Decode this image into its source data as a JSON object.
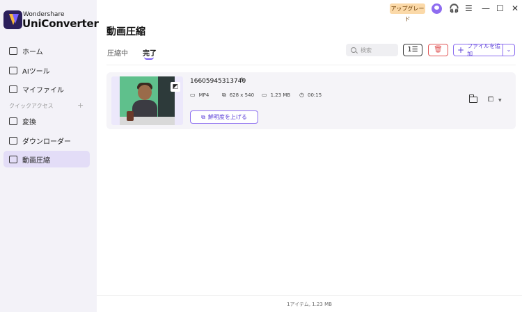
{
  "app": {
    "brand_small": "Wondershare",
    "brand_big": "UniConverter"
  },
  "topbar": {
    "upgrade_label": "アップグレード",
    "icons": [
      "avatar-icon",
      "headset-icon",
      "menu-list-icon",
      "minimize-icon",
      "maximize-icon",
      "close-icon"
    ],
    "glyphs": {
      "headset": "🎧",
      "menu": "☰",
      "minimize": "—",
      "maximize": "☐",
      "close": "✕"
    }
  },
  "sidebar": {
    "items": [
      {
        "label": "ホーム",
        "icon": "home-icon"
      },
      {
        "label": "AIツール",
        "icon": "ai-tools-icon"
      },
      {
        "label": "マイファイル",
        "icon": "my-files-icon"
      }
    ],
    "quick_access_label": "クイックアクセス",
    "quick_access_plus": "+",
    "quick_items": [
      {
        "label": "変換",
        "icon": "convert-icon"
      },
      {
        "label": "ダウンローダー",
        "icon": "downloader-icon"
      },
      {
        "label": "動画圧縮",
        "icon": "video-compress-icon",
        "active": true
      }
    ]
  },
  "main": {
    "title": "動画圧縮",
    "tabs": [
      {
        "label": "圧縮中",
        "active": false
      },
      {
        "label": "完了",
        "active": true
      }
    ],
    "search_placeholder": "検索",
    "list_button_glyph": "1☰",
    "trash_glyph": "🗑",
    "add_file_label": "ファイルを追加",
    "add_file_plus": "+",
    "add_dropdown_glyph": "⌄"
  },
  "file": {
    "name": "16605945313740",
    "edit_glyph": "✎",
    "format": "MP4",
    "resolution": "628 x 540",
    "size": "1.23 MB",
    "duration": "00:15",
    "meta_glyphs": {
      "format": "▭",
      "resolution": "⧉",
      "size": "▭",
      "duration": "◷"
    },
    "thumb_badge_glyph": "◩",
    "enhance_label": "鮮明度を上げる",
    "enhance_glyph": "⧉",
    "crop_glyph": "⧠",
    "crop_dropdown_glyph": "▼"
  },
  "footer": {
    "summary": "1アイテム, 1.23 MB"
  },
  "colors": {
    "accent": "#7b5cf0",
    "sidebar_bg": "#f3f2f8",
    "active_nav": "#e3ddf7",
    "trash": "#e05555",
    "upgrade_bg": "#fbd9a8"
  }
}
